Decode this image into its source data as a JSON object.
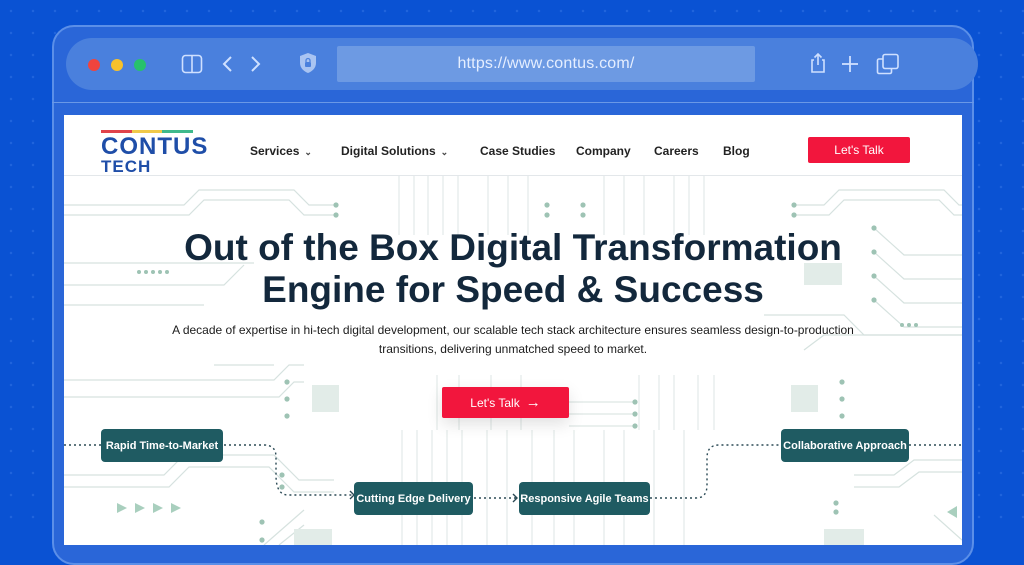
{
  "browser": {
    "url": "https://www.contus.com/",
    "icons": [
      "sidebar-icon",
      "back-icon",
      "forward-icon",
      "shield-lock-icon",
      "share-icon",
      "new-tab-icon",
      "tabs-icon"
    ]
  },
  "site": {
    "logo": {
      "line1": "CONTUS",
      "line2": "TECH",
      "bar_colors": [
        "#e0434b",
        "#f0c94a",
        "#3fb98c"
      ]
    },
    "nav": [
      {
        "label": "Services",
        "has_dropdown": true
      },
      {
        "label": "Digital Solutions",
        "has_dropdown": true
      },
      {
        "label": "Case Studies",
        "has_dropdown": false
      },
      {
        "label": "Company",
        "has_dropdown": false
      },
      {
        "label": "Careers",
        "has_dropdown": false
      },
      {
        "label": "Blog",
        "has_dropdown": false
      }
    ],
    "nav_cta": "Let's Talk",
    "hero": {
      "title_line1": "Out of the Box Digital Transformation",
      "title_line2": "Engine for Speed & Success",
      "subtitle_line1": "A decade of expertise in hi-tech digital development, our scalable tech stack architecture ensures seamless design-to-production",
      "subtitle_line2": "transitions, delivering unmatched speed to market.",
      "cta": "Let's Talk",
      "cta_icon": "→"
    },
    "features": [
      "Rapid Time-to-Market",
      "Cutting Edge Delivery",
      "Responsive Agile Teams",
      "Collaborative Approach"
    ],
    "colors": {
      "accent": "#f2163d",
      "pill": "#1f5b62",
      "heading": "#13283c",
      "circuit": "#cfdcd8",
      "node": "#9ec3b4"
    }
  }
}
